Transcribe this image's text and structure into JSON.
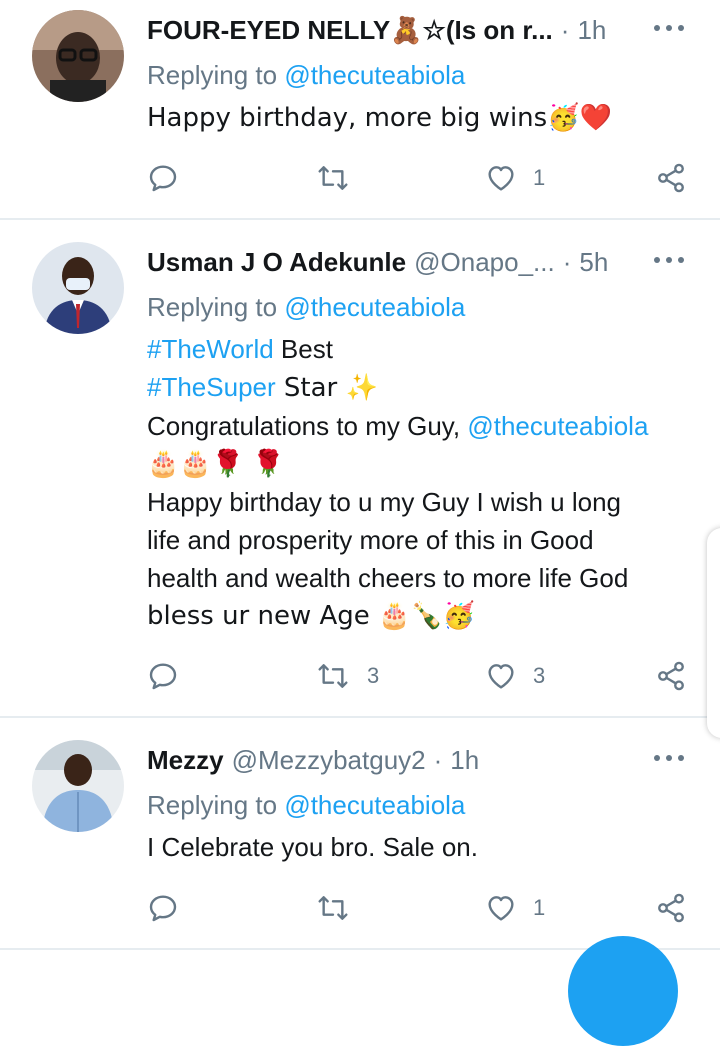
{
  "tweets": [
    {
      "name": "FOUR-EYED NELLY🧸☆(Is on r...",
      "handle": "",
      "dot": "·",
      "time": "1h",
      "replying_prefix": "Replying to",
      "replying_to": "@thecuteabiola",
      "lines": [
        "Happy birthday, more big wins🥳❤️"
      ],
      "retweets": "",
      "likes": "1"
    },
    {
      "name": "Usman J O Adekunle",
      "handle": "@Onapo_...",
      "dot": "·",
      "time": "5h",
      "replying_prefix": "Replying to",
      "replying_to": "@thecuteabiola",
      "line1_tag": "#TheWorld",
      "line1_text": " Best",
      "line2_tag": "#TheSuper",
      "line2_text": " Star ✨",
      "line3_text": "Congratulations to my Guy, ",
      "line3_mention": "@thecuteabiola",
      "line4": "🎂🎂🌹 🌹",
      "line5": "Happy birthday to u my Guy  I wish u long",
      "line6": "life and prosperity more of this in Good",
      "line7": "health and wealth cheers to more life God",
      "line8": "bless ur new Age 🎂🍾🥳",
      "retweets": "3",
      "likes": "3"
    },
    {
      "name": "Mezzy",
      "handle": "@Mezzybatguy2",
      "dot": "·",
      "time": "1h",
      "replying_prefix": "Replying to",
      "replying_to": "@thecuteabiola",
      "lines": [
        "I Celebrate you bro. Sale on."
      ],
      "retweets": "",
      "likes": "1"
    }
  ],
  "icons": {
    "reply": "reply-icon",
    "retweet": "retweet-icon",
    "like": "heart-icon",
    "share": "share-icon",
    "more": "more-options-icon"
  },
  "colors": {
    "accent": "#1da1f2",
    "secondary_text": "#657786",
    "divider": "#e6ecf0"
  }
}
